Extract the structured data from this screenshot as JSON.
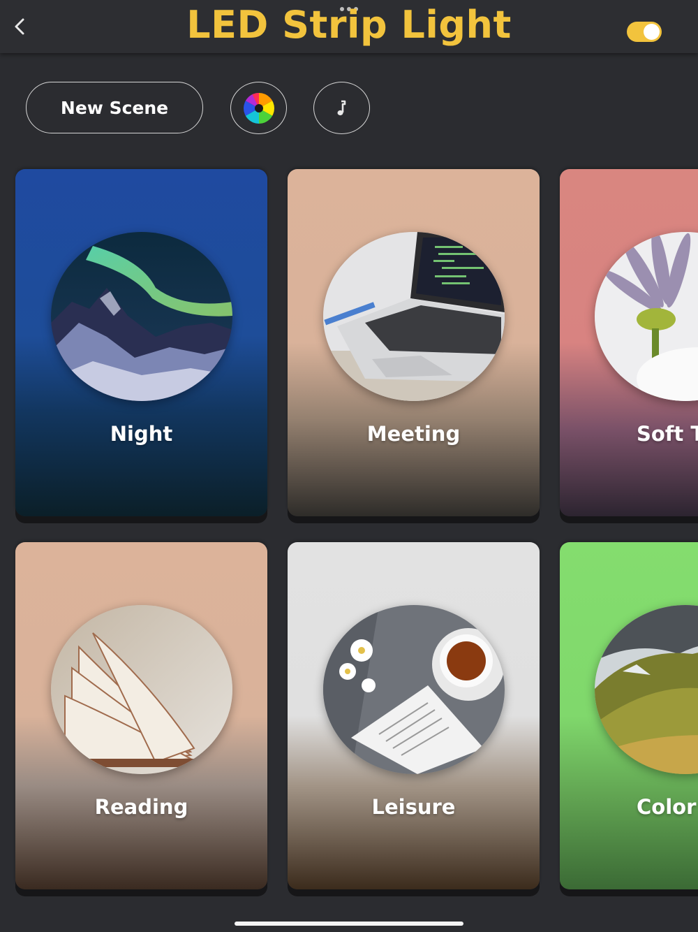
{
  "header": {
    "title": "LED Strip Light",
    "power_on": true
  },
  "toolbar": {
    "new_scene_label": "New Scene",
    "color_wheel_icon": "color-wheel-icon",
    "music_icon": "music-note-icon"
  },
  "scenes": [
    {
      "label": "Night",
      "colors": {
        "top": "#1f4aa0",
        "bottom": "#0b1f28"
      }
    },
    {
      "label": "Meeting",
      "colors": {
        "top": "#dcb39a",
        "bottom": "#2e2c29"
      }
    },
    {
      "label": "Soft T",
      "colors": {
        "top": "#d98680",
        "bottom": "#2c2430"
      }
    },
    {
      "label": "Reading",
      "colors": {
        "top": "#dcb39a",
        "bottom": "#3a2a20"
      }
    },
    {
      "label": "Leisure",
      "colors": {
        "top": "#e2e2e2",
        "bottom": "#3b2b1c"
      }
    },
    {
      "label": "Color",
      "colors": {
        "top": "#84dd6e",
        "bottom": "#3b6a35"
      }
    }
  ]
}
